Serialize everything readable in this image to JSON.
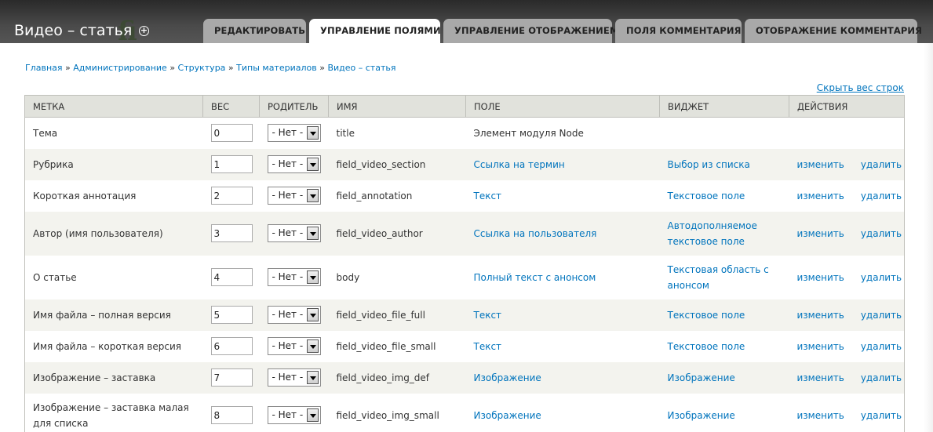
{
  "header": {
    "page_title": "Видео – статья",
    "tabs": [
      {
        "label": "РЕДАКТИРОВАТЬ",
        "active": false
      },
      {
        "label": "УПРАВЛЕНИЕ ПОЛЯМИ",
        "active": true
      },
      {
        "label": "УПРАВЛЕНИЕ ОТОБРАЖЕНИЕМ",
        "active": false
      },
      {
        "label": "ПОЛЯ КОММЕНТАРИЯ",
        "active": false
      },
      {
        "label": "ОТОБРАЖЕНИЕ КОММЕНТАРИЯ",
        "active": false
      }
    ]
  },
  "breadcrumb": {
    "items": [
      "Главная",
      "Администрирование",
      "Структура",
      "Типы материалов",
      "Видео – статья"
    ],
    "separator": "»"
  },
  "toggle_weight_label": "Скрыть вес строк",
  "table": {
    "columns": [
      "МЕТКА",
      "ВЕС",
      "РОДИТЕЛЬ",
      "ИМЯ",
      "ПОЛЕ",
      "ВИДЖЕТ",
      "ДЕЙСТВИЯ"
    ],
    "parent_value": "- Нет -",
    "edit_label": "изменить",
    "delete_label": "удалить",
    "rows": [
      {
        "label": "Тема",
        "weight": "0",
        "name": "title",
        "field": "Элемент модуля Node",
        "field_link": false,
        "widget": "",
        "ops": false
      },
      {
        "label": "Рубрика",
        "weight": "1",
        "name": "field_video_section",
        "field": "Ссылка на термин",
        "field_link": true,
        "widget": "Выбор из списка",
        "ops": true
      },
      {
        "label": "Короткая аннотация",
        "weight": "2",
        "name": "field_annotation",
        "field": "Текст",
        "field_link": true,
        "widget": "Текстовое поле",
        "ops": true
      },
      {
        "label": "Автор (имя пользователя)",
        "weight": "3",
        "name": "field_video_author",
        "field": "Ссылка на пользователя",
        "field_link": true,
        "widget": "Автодополняемое текстовое поле",
        "ops": true
      },
      {
        "label": "О статье",
        "weight": "4",
        "name": "body",
        "field": "Полный текст с анонсом",
        "field_link": true,
        "widget": "Текстовая область с анонсом",
        "ops": true
      },
      {
        "label": "Имя файла – полная версия",
        "weight": "5",
        "name": "field_video_file_full",
        "field": "Текст",
        "field_link": true,
        "widget": "Текстовое поле",
        "ops": true
      },
      {
        "label": "Имя файла – короткая версия",
        "weight": "6",
        "name": "field_video_file_small",
        "field": "Текст",
        "field_link": true,
        "widget": "Текстовое поле",
        "ops": true
      },
      {
        "label": "Изображение – заставка",
        "weight": "7",
        "name": "field_video_img_def",
        "field": "Изображение",
        "field_link": true,
        "widget": "Изображение",
        "ops": true
      },
      {
        "label": "Изображение – заставка малая для списка",
        "weight": "8",
        "name": "field_video_img_small",
        "field": "Изображение",
        "field_link": true,
        "widget": "Изображение",
        "ops": true
      }
    ]
  },
  "colors": {
    "link": "#0074bd",
    "header_bg": "#e1e2dc",
    "row_alt": "#f3f3ee"
  }
}
